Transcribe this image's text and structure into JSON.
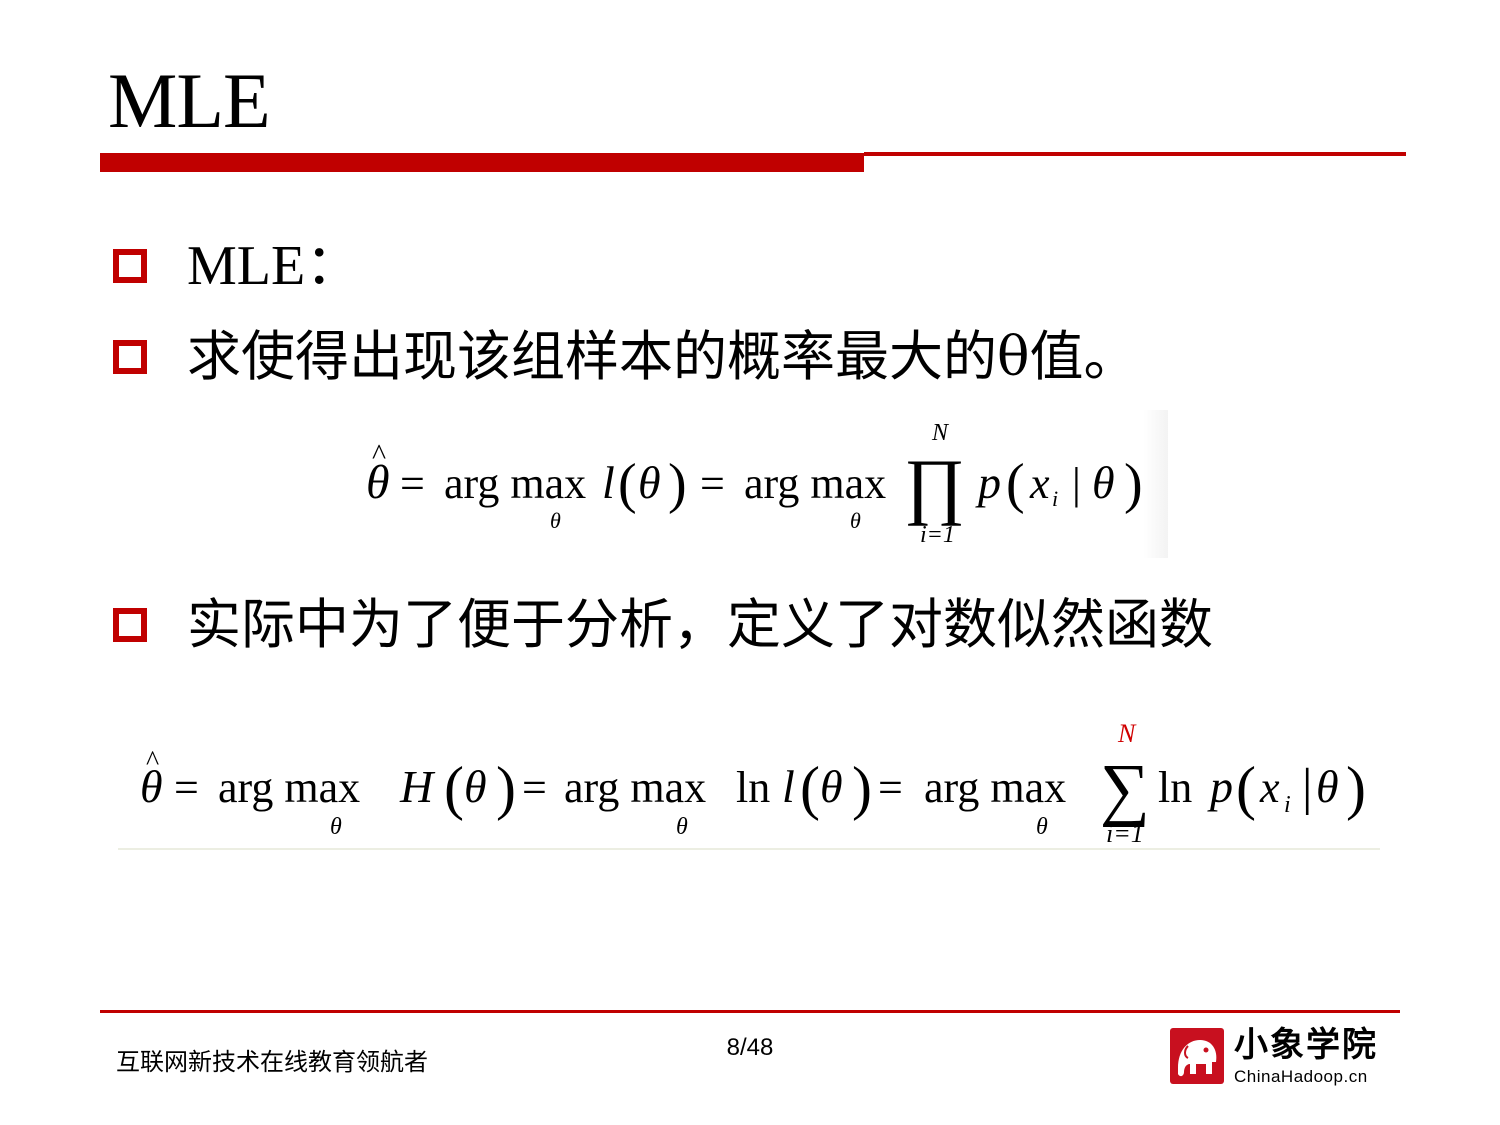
{
  "slide": {
    "title": "MLE",
    "bullets": [
      {
        "text": "MLE："
      },
      {
        "text": "求使得出现该组样本的概率最大的θ值。"
      },
      {
        "text": "实际中为了便于分析，定义了对数似然函数"
      }
    ]
  },
  "formulas": {
    "f1": {
      "lhs": "θ",
      "hat": "^",
      "eq": "=",
      "argmax": "arg max",
      "sub": "θ",
      "l": "l",
      "lparen": "(",
      "rparen": ")",
      "prod": "∏",
      "upper": "N",
      "lower": "i=1",
      "p": "p",
      "x": "x",
      "i": "i",
      "bar": "|"
    },
    "f2": {
      "lhs": "θ",
      "hat": "^",
      "eq": "=",
      "argmax": "arg max",
      "sub": "θ",
      "H": "H",
      "ln": "ln",
      "l": "l",
      "sum": "∑",
      "upper": "N",
      "lower": "i=1",
      "p": "p",
      "x": "x",
      "i": "i",
      "bar": "|",
      "lparen": "(",
      "rparen": ")"
    }
  },
  "footer": {
    "slogan": "互联网新技术在线教育领航者",
    "page_number": "8/48",
    "logo_name": "小象学院",
    "logo_url": "ChinaHadoop.cn"
  },
  "colors": {
    "accent": "#c00000",
    "logo_red": "#c8101f"
  }
}
